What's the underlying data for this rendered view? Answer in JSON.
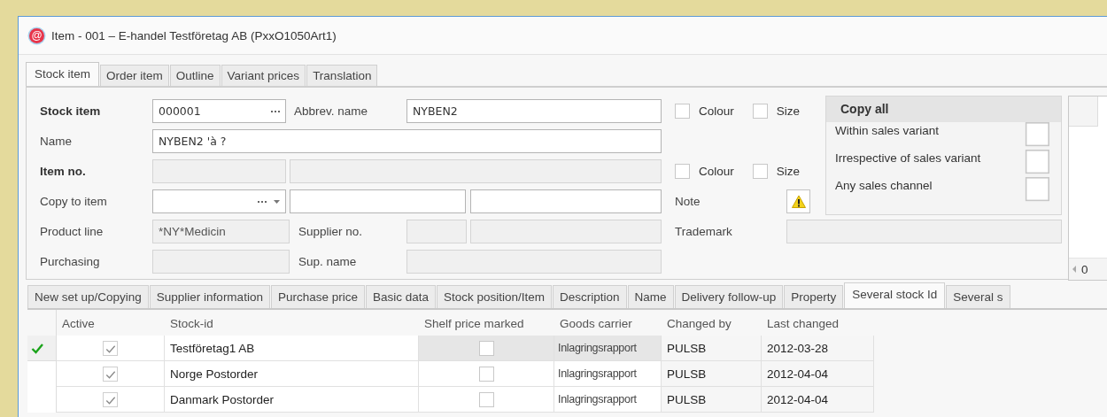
{
  "window": {
    "icon": "@",
    "title": "Item - 001 – E-handel Testföretag AB (PxxO1050Art1)"
  },
  "tabs": [
    {
      "label": "Stock item",
      "selected": true
    },
    {
      "label": "Order item",
      "selected": false
    },
    {
      "label": "Outline",
      "selected": false
    },
    {
      "label": "Variant prices",
      "selected": false
    },
    {
      "label": "Translation",
      "selected": false
    }
  ],
  "form": {
    "stock_item": {
      "label": "Stock item",
      "fields": [
        {
          "value": "000001",
          "disabled": false
        }
      ]
    },
    "abbrev_name": {
      "label": "Abbrev. name",
      "fields": [
        {
          "value": "NYBEN2",
          "disabled": false
        }
      ]
    },
    "name": {
      "label": "Name",
      "fields": [
        {
          "value": "NYBEN2  'à ?",
          "disabled": false
        }
      ]
    },
    "item_no": {
      "label": "Item no.",
      "fields": [
        {
          "disabled": true
        },
        {
          "disabled": true
        }
      ]
    },
    "copy_to_item": {
      "label": "Copy to item",
      "fields": [
        {
          "disabled": false
        },
        {
          "disabled": false
        },
        {
          "disabled": false
        }
      ]
    },
    "product_line": {
      "label": "Product line",
      "fields": [
        {
          "value": "*NY*Medicin",
          "disabled": true
        }
      ]
    },
    "supplier_no": {
      "label": "Supplier no.",
      "fields": [
        {
          "disabled": true
        },
        {
          "disabled": true
        }
      ]
    },
    "purchasing": {
      "label": "Purchasing",
      "fields": [
        {
          "disabled": true
        }
      ]
    },
    "sup_name": {
      "label": "Sup. name",
      "fields": [
        {
          "disabled": true
        }
      ]
    },
    "variant_options_top": [
      {
        "label": "Colour",
        "checked": false
      },
      {
        "label": "Size",
        "checked": false
      }
    ],
    "variant_options_item_no": [
      {
        "label": "Colour",
        "checked": false
      },
      {
        "label": "Size",
        "checked": false
      }
    ],
    "note": {
      "label": "Note"
    },
    "trademark": {
      "label": "Trademark",
      "fields": [
        {
          "disabled": true
        }
      ]
    },
    "copy_all": {
      "title": "Copy all",
      "options": [
        {
          "label": "Within sales variant",
          "checked": false
        },
        {
          "label": "Irrespective of sales variant",
          "checked": false
        },
        {
          "label": "Any sales channel",
          "checked": false
        }
      ]
    },
    "side_panel": {
      "scroll_value": "0"
    }
  },
  "detail_tabs": [
    {
      "label": "New set up/Copying",
      "selected": false
    },
    {
      "label": "Supplier information",
      "selected": false
    },
    {
      "label": "Purchase price",
      "selected": false
    },
    {
      "label": "Basic data",
      "selected": false
    },
    {
      "label": "Stock position/Item",
      "selected": false
    },
    {
      "label": "Description",
      "selected": false
    },
    {
      "label": "Name",
      "selected": false
    },
    {
      "label": "Delivery follow-up",
      "selected": false
    },
    {
      "label": "Property",
      "selected": false
    },
    {
      "label": "Several stock Id",
      "selected": true
    },
    {
      "label": "Several s",
      "selected": false
    }
  ],
  "grid": {
    "columns": [
      "Active",
      "Stock-id",
      "Shelf price marked",
      "Goods carrier",
      "Changed by",
      "Last changed"
    ],
    "rows": [
      {
        "current": true,
        "active": true,
        "stock_id": "Testföretag1 AB",
        "shelf_price_marked": false,
        "goods_carrier": "Inlagringsrapport",
        "changed_by": "PULSB",
        "last_changed": "2012-03-28"
      },
      {
        "current": false,
        "active": true,
        "stock_id": "Norge Postorder",
        "shelf_price_marked": false,
        "goods_carrier": "Inlagringsrapport",
        "changed_by": "PULSB",
        "last_changed": "2012-04-04"
      },
      {
        "current": false,
        "active": true,
        "stock_id": "Danmark Postorder",
        "shelf_price_marked": false,
        "goods_carrier": "Inlagringsrapport",
        "changed_by": "PULSB",
        "last_changed": "2012-04-04"
      }
    ]
  }
}
